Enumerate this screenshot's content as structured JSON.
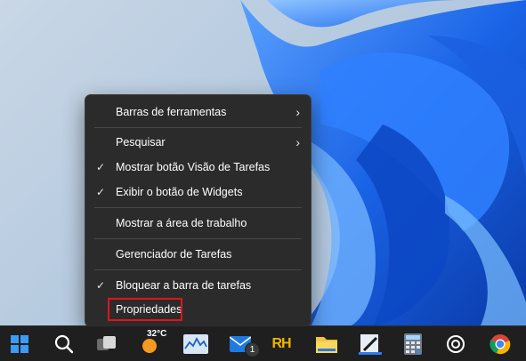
{
  "context_menu": {
    "items": [
      {
        "label": "Barras de ferramentas",
        "checked": false,
        "submenu": true
      },
      {
        "label": "Pesquisar",
        "checked": false,
        "submenu": true
      },
      {
        "label": "Mostrar botão Visão de Tarefas",
        "checked": true,
        "submenu": false
      },
      {
        "label": "Exibir o botão de Widgets",
        "checked": true,
        "submenu": false
      },
      {
        "label": "Mostrar a área de trabalho",
        "checked": false,
        "submenu": false
      },
      {
        "label": "Gerenciador de Tarefas",
        "checked": false,
        "submenu": false
      },
      {
        "label": "Bloquear a barra de tarefas",
        "checked": true,
        "submenu": false
      },
      {
        "label": "Propriedades",
        "checked": false,
        "submenu": false
      }
    ],
    "highlighted_item": "Propriedades",
    "check_glyph": "✓",
    "arrow_glyph": "›"
  },
  "taskbar": {
    "weather_temp": "32°C",
    "mail_badge": "1",
    "rh_label": "RH",
    "icons": [
      "start-icon",
      "search-icon",
      "task-view-icon",
      "weather-icon",
      "stock-chart-app-icon",
      "mail-icon",
      "rh-app-icon",
      "file-explorer-icon",
      "drawing-app-icon",
      "calculator-icon",
      "chatgpt-icon",
      "chrome-icon"
    ]
  },
  "colors": {
    "menu_bg": "#2b2b2b",
    "highlight_border": "#e0141c",
    "taskbar_bg": "#1f1f1f"
  }
}
